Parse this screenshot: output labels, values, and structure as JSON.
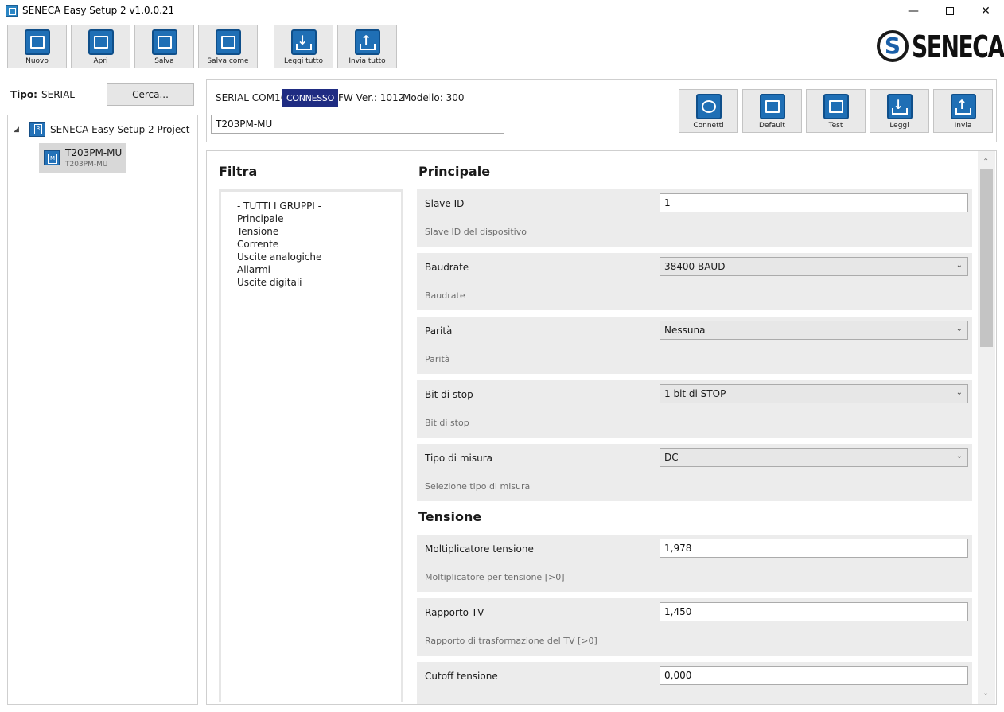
{
  "window": {
    "title": "SENECA Easy Setup 2 v1.0.0.21",
    "minimize": "—",
    "close": "✕"
  },
  "toolbar": {
    "new_label": "Nuovo",
    "open_label": "Apri",
    "save_label": "Salva",
    "save_as_label": "Salva come",
    "read_all_label": "Leggi tutto",
    "send_all_label": "Invia tutto"
  },
  "brand": {
    "logo_text": "SENECA",
    "logo_letter": "S",
    "logo_color": "#1a5fa8"
  },
  "sidebar": {
    "type_label": "Tipo:",
    "type_value": "SERIAL",
    "search_label": "Cerca...",
    "tree_toggle": "◢",
    "project_label": "SENECA Easy Setup 2 Project",
    "device_title": "T203PM-MU",
    "device_subtitle": "T203PM-MU"
  },
  "device": {
    "port": "SERIAL COM16",
    "status": "CONNESSO",
    "status_color": "#1f2c82",
    "fw": "FW Ver.: 1012",
    "model": "Modello:  300",
    "name_value": "T203PM-MU",
    "buttons": {
      "connect": "Connetti",
      "default": "Default",
      "test": "Test",
      "read": "Leggi",
      "send": "Invia"
    }
  },
  "filter": {
    "title": "Filtra",
    "items": [
      "- TUTTI I GRUPPI -",
      "Principale",
      "Tensione",
      "Corrente",
      "Uscite analogiche",
      "Allarmi",
      "Uscite digitali"
    ]
  },
  "sections": {
    "principale": "Principale",
    "tensione": "Tensione"
  },
  "params": [
    {
      "label": "Slave ID",
      "value": "1",
      "desc": "Slave ID del dispositivo"
    },
    {
      "label": "Baudrate",
      "value": "38400 BAUD",
      "desc": "Baudrate"
    },
    {
      "label": "Parità",
      "value": "Nessuna",
      "desc": "Parità"
    },
    {
      "label": "Bit di stop",
      "value": "1 bit di STOP",
      "desc": "Bit di stop"
    },
    {
      "label": "Tipo di misura",
      "value": "DC",
      "desc": "Selezione tipo di misura"
    },
    {
      "label": "Moltiplicatore tensione",
      "value": "1,978",
      "desc": "Moltiplicatore per tensione [>0]"
    },
    {
      "label": "Rapporto TV",
      "value": "1,450",
      "desc": "Rapporto di trasformazione del TV [>0]"
    },
    {
      "label": "Cutoff tensione",
      "value": "0,000",
      "desc": ""
    }
  ],
  "scroll": {
    "up": "⌃",
    "down": "⌄",
    "position": 0.0
  },
  "icons": {
    "select_chevron": "⌄"
  }
}
